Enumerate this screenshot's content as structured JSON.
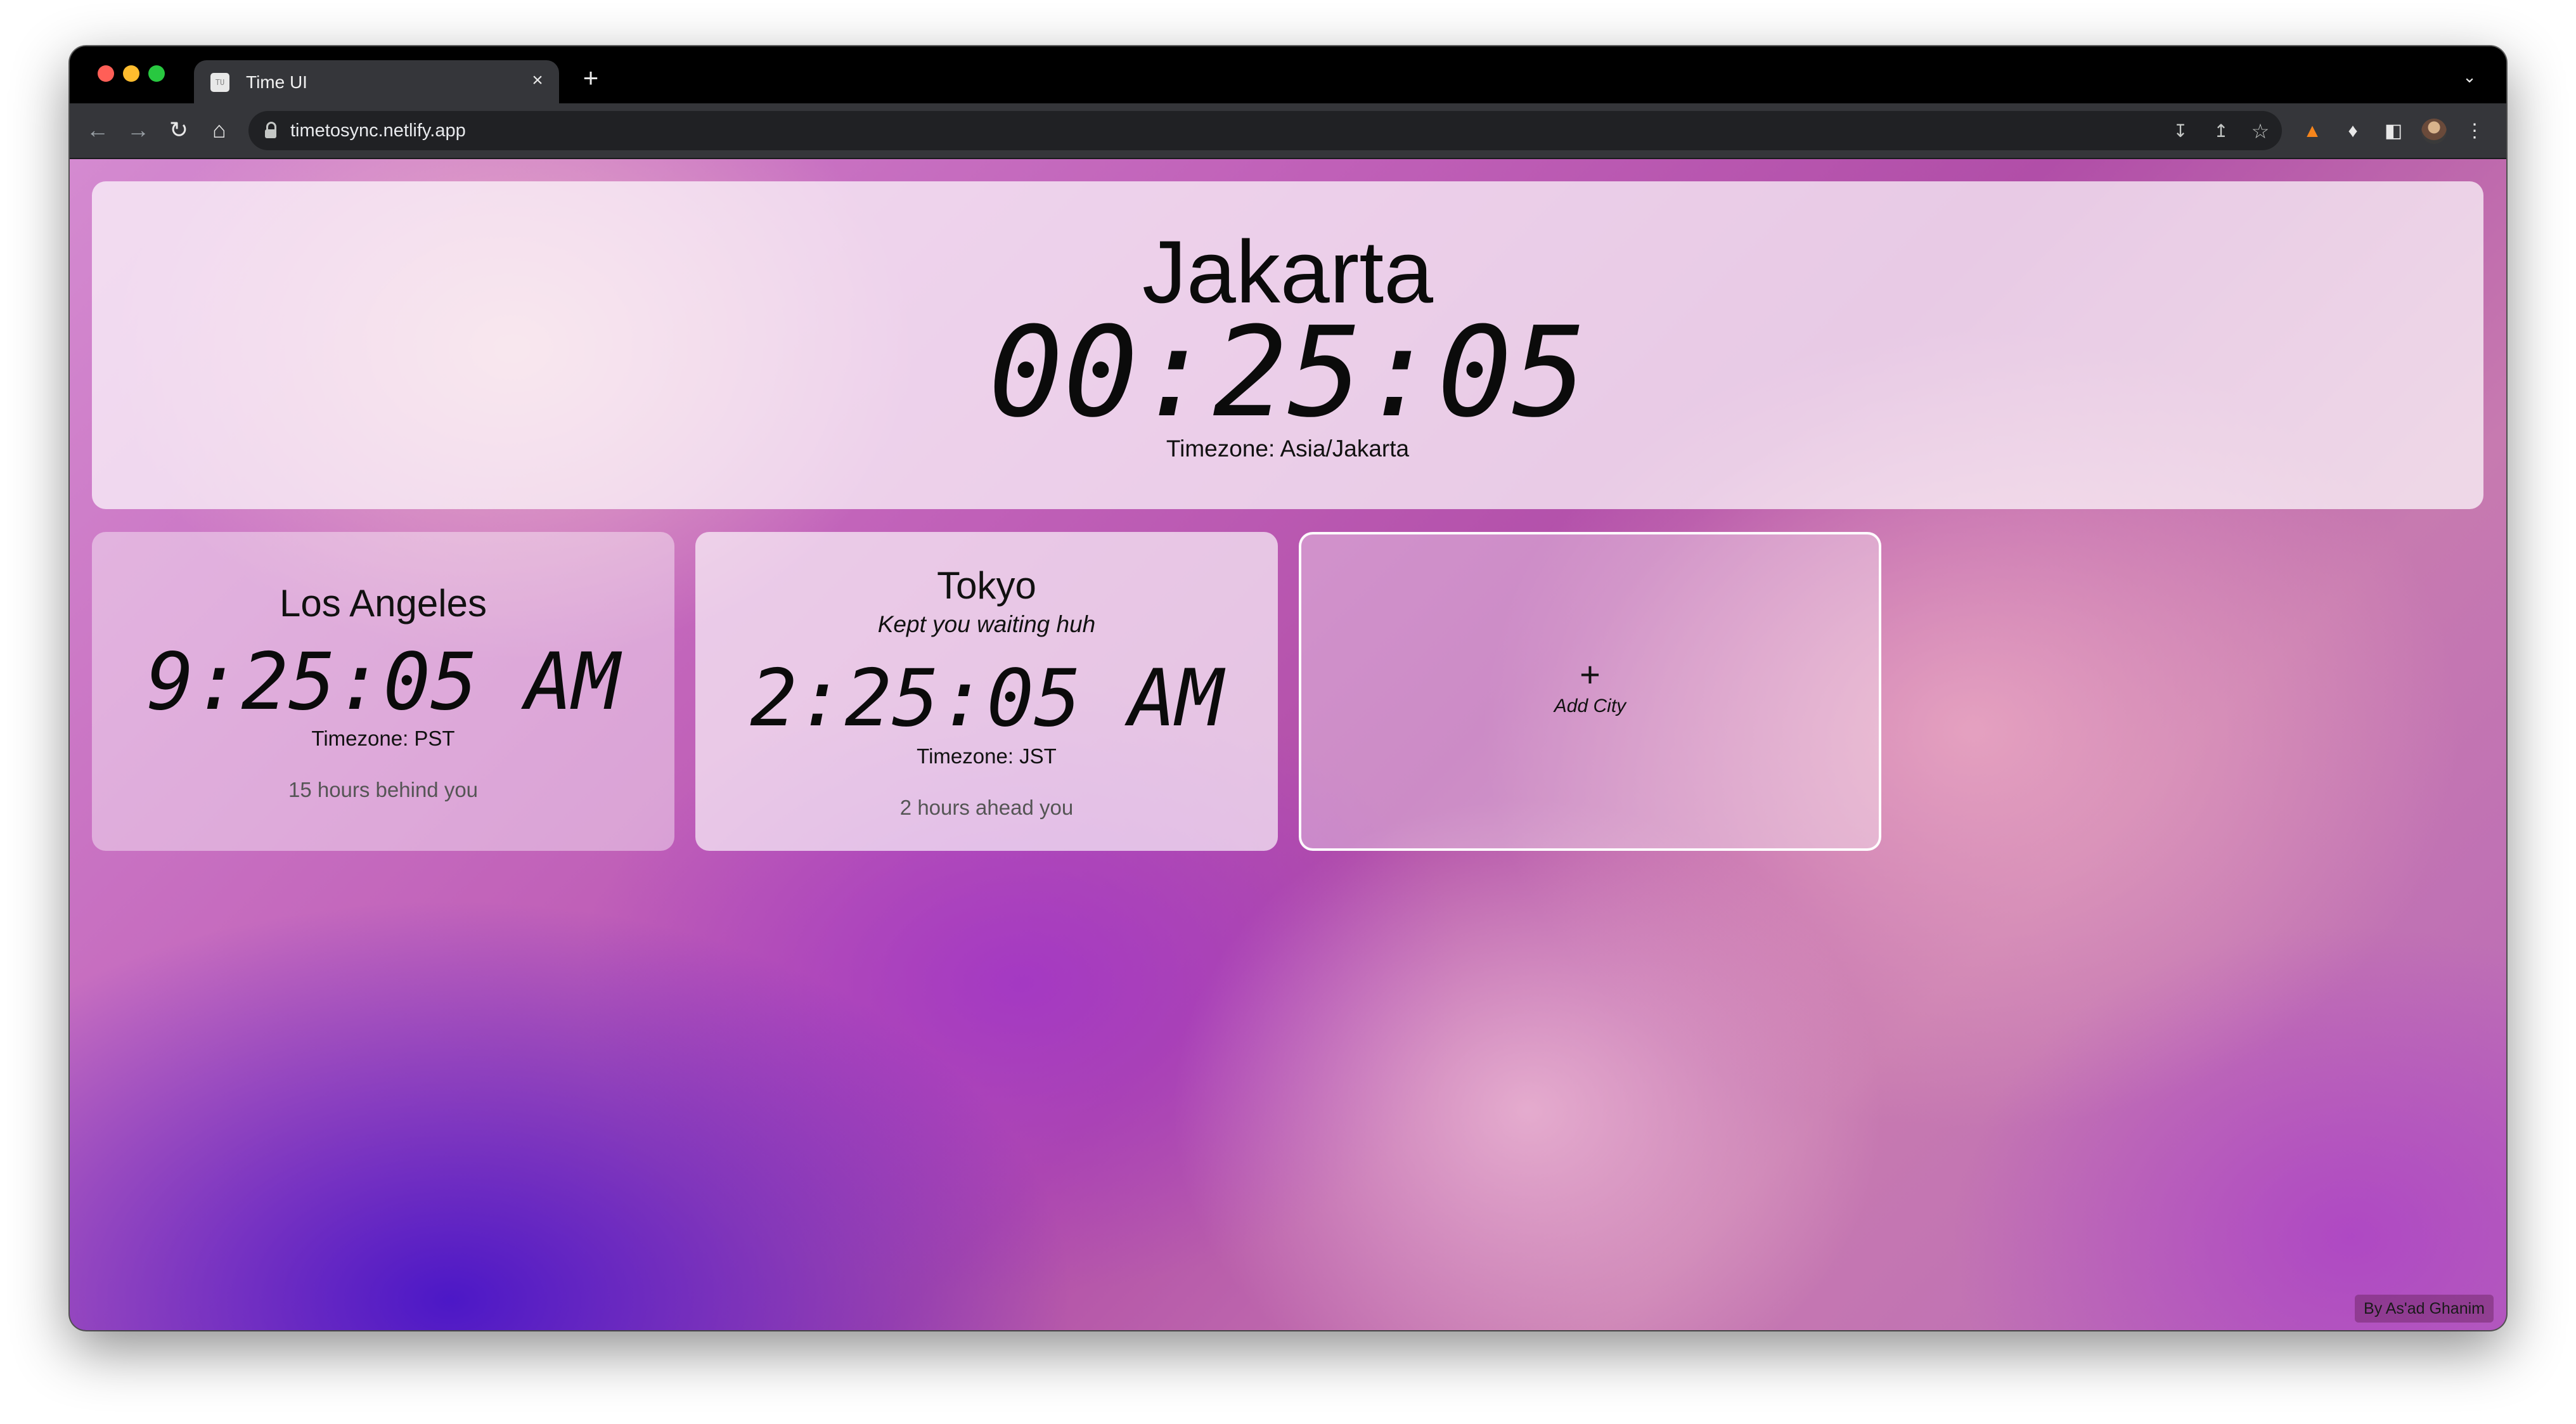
{
  "browser": {
    "tab_title": "Time UI",
    "tab_favicon_text": "TU",
    "tab_close": "×",
    "new_tab": "+",
    "url": "timetosync.netlify.app",
    "icons": [
      "back-arrow-icon",
      "forward-arrow-icon",
      "reload-icon",
      "home-icon",
      "lock-icon",
      "install-icon",
      "share-icon",
      "star-icon",
      "metamask-fox-icon",
      "puzzle-extensions-icon",
      "side-panel-icon",
      "profile-avatar-icon",
      "kebab-menu-icon"
    ]
  },
  "primary_city": {
    "name": "Jakarta",
    "time": "00:25:05",
    "timezone": "Timezone: Asia/Jakarta"
  },
  "cities": [
    {
      "name": "Los Angeles",
      "note": "",
      "time": "9:25:05 AM",
      "timezone": "Timezone: PST",
      "difference": "15 hours behind you"
    },
    {
      "name": "Tokyo",
      "note": "Kept you waiting huh",
      "time": "2:25:05 AM",
      "timezone": "Timezone: JST",
      "difference": "2 hours ahead you"
    }
  ],
  "add_city": {
    "icon": "+",
    "label": "Add City"
  },
  "credit": "By As'ad Ghanim"
}
